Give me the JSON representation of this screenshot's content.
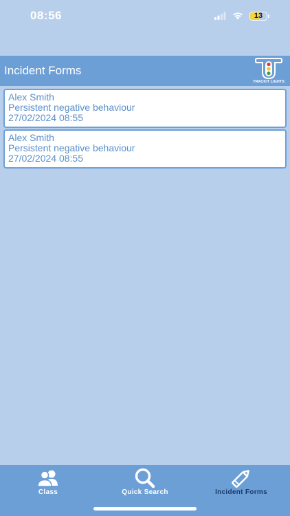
{
  "status_bar": {
    "time": "08:56",
    "battery_level": "13",
    "battery_fraction": 0.13,
    "battery_color": "#f5d442"
  },
  "header": {
    "title": "Incident Forms",
    "logo_text": "TRACKIT LIGHTS",
    "background": "#6d9fd7"
  },
  "incidents": [
    {
      "name": "Alex Smith",
      "reason": "Persistent negative behaviour",
      "datetime": "27/02/2024 08:55"
    },
    {
      "name": "Alex Smith",
      "reason": "Persistent negative behaviour",
      "datetime": "27/02/2024 08:55"
    }
  ],
  "tabbar": {
    "tabs": [
      {
        "label": "Class",
        "icon": "users-icon",
        "active": false
      },
      {
        "label": "Quick Search",
        "icon": "search-icon",
        "active": false
      },
      {
        "label": "Incident Forms",
        "icon": "pencil-icon",
        "active": true
      }
    ]
  },
  "colors": {
    "page_background": "#b8cfeb",
    "accent": "#6d9fd7",
    "text_blue": "#5b8fc9",
    "active_tab_text": "#1a3a6b"
  }
}
